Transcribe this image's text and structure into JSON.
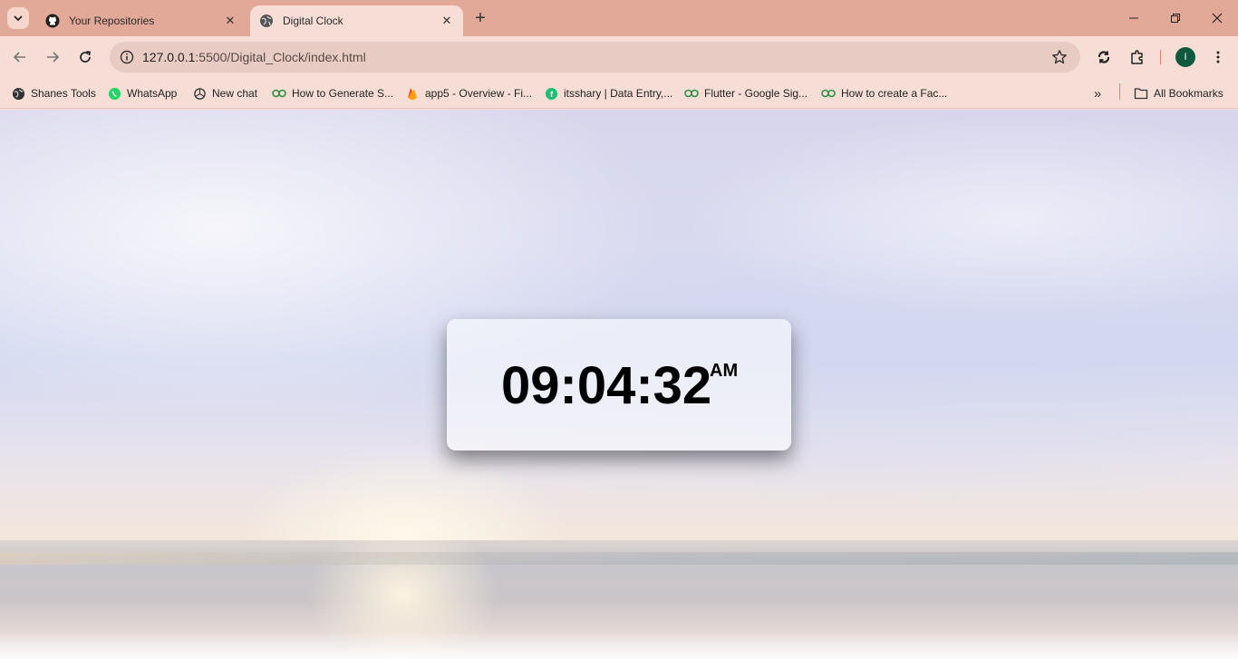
{
  "browser": {
    "tabs": [
      {
        "title": "Your Repositories",
        "icon": "github-icon",
        "active": false
      },
      {
        "title": "Digital Clock",
        "icon": "globe-icon",
        "active": true
      }
    ],
    "address": {
      "host": "127.0.0.1",
      "path": ":5500/Digital_Clock/index.html"
    },
    "profile_initial": "I",
    "bookmarks": [
      {
        "label": "Shanes Tools",
        "icon": "globe-icon"
      },
      {
        "label": "WhatsApp",
        "icon": "whatsapp-icon"
      },
      {
        "label": "New chat",
        "icon": "openai-icon"
      },
      {
        "label": "How to Generate S...",
        "icon": "geeks-icon"
      },
      {
        "label": "app5 - Overview - Fi...",
        "icon": "firebase-icon"
      },
      {
        "label": "itsshary | Data Entry,...",
        "icon": "fiverr-icon"
      },
      {
        "label": "Flutter - Google Sig...",
        "icon": "geeks-icon"
      },
      {
        "label": "How to create a Fac...",
        "icon": "geeks-icon"
      }
    ],
    "all_bookmarks_label": "All Bookmarks"
  },
  "page": {
    "clock": {
      "time": "09:04:32",
      "period": "AM"
    }
  },
  "colors": {
    "tabstrip": "#e3a998",
    "toolbar": "#f6ded6",
    "omnibox": "#e8ccc3",
    "avatar": "#0f5a3e"
  }
}
